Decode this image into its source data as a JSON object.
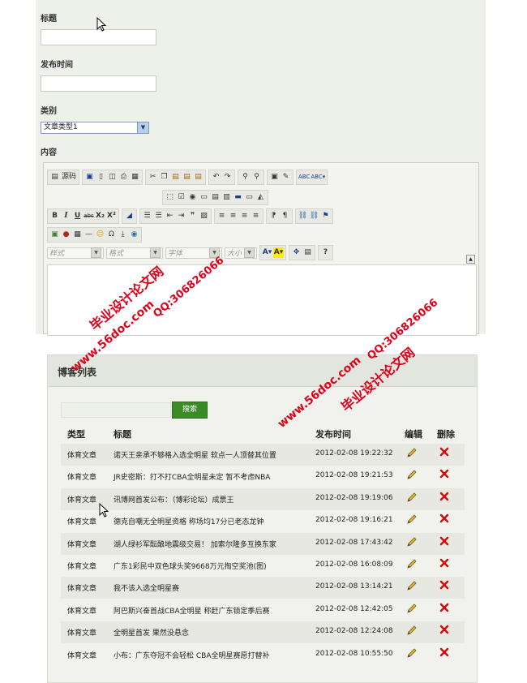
{
  "form": {
    "title_label": "标题",
    "publish_time_label": "发布时间",
    "category_label": "类别",
    "category_selected": "文章类型1",
    "content_label": "内容"
  },
  "editor": {
    "row1": {
      "source_label": "源码"
    },
    "row3": {
      "bold": "B",
      "italic": "I",
      "underline": "U",
      "strike": "abc",
      "sub": "X₂",
      "sup": "X²"
    },
    "row4": {
      "style_combo": "样式",
      "format_combo": "格式",
      "font_combo": "字体",
      "size_combo": "大小"
    }
  },
  "list": {
    "header_title": "博客列表",
    "search_button": "搜索",
    "columns": [
      "类型",
      "标题",
      "发布时间",
      "编辑",
      "删除"
    ],
    "rows": [
      {
        "type": "体育文章",
        "title": "诺天王亲承不够格入选全明星 软点一人顶替其位置",
        "time": "2012-02-08 19:22:32"
      },
      {
        "type": "体育文章",
        "title": "JR史密斯：打不打CBA全明星未定 暂不考虑NBA",
        "time": "2012-02-08 19:21:53"
      },
      {
        "type": "体育文章",
        "title": "讯博网首发公布：（博彩论坛）成票王",
        "time": "2012-02-08 19:19:06"
      },
      {
        "type": "体育文章",
        "title": "德克自嘲无全明星资格 称场均17分已老态龙钟",
        "time": "2012-02-08 19:16:21"
      },
      {
        "type": "体育文章",
        "title": "湖人绿衫军酝酿地震级交易！ 加索尔隆多互换东家",
        "time": "2012-02-08 17:43:42"
      },
      {
        "type": "体育文章",
        "title": "广东1彩民中双色球头奖9668万元掏空奖池(图)",
        "time": "2012-02-08 16:08:09"
      },
      {
        "type": "体育文章",
        "title": "我不该入选全明星赛",
        "time": "2012-02-08 13:14:21"
      },
      {
        "type": "体育文章",
        "title": "阿巴斯兴奋首战CBA全明星 称赶广东锁定季后赛",
        "time": "2012-02-08 12:42:05"
      },
      {
        "type": "体育文章",
        "title": "全明星首发 果然没悬念",
        "time": "2012-02-08 12:24:08"
      },
      {
        "type": "体育文章",
        "title": "小布：广东夺冠不会轻松 CBA全明星赛愿打替补",
        "time": "2012-02-08 10:55:50"
      }
    ],
    "edit_icon": "pencil-icon",
    "delete_icon": "red-x-icon"
  },
  "watermark": {
    "site": "www.56doc.com",
    "qq": "QQ:306826066",
    "brand": "毕业设计论文网"
  },
  "colors": {
    "panel_bg": "#eef0ea",
    "search_button": "#3b8b26",
    "watermark": "#e0001a",
    "delete_red": "#cc1111"
  }
}
